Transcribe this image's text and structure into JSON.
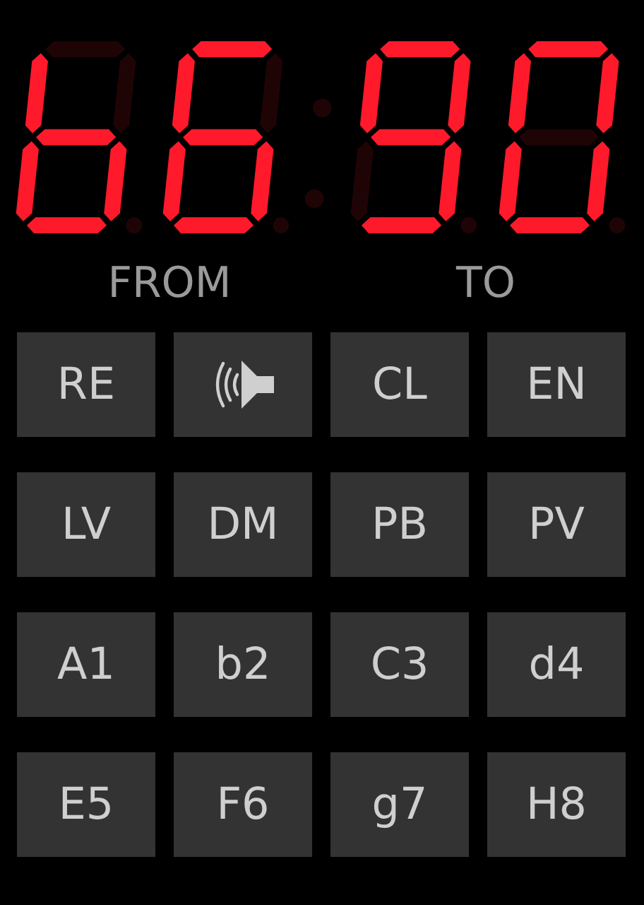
{
  "display": {
    "digits": [
      {
        "segments": [
          false,
          false,
          true,
          true,
          true,
          true,
          true
        ],
        "dot": false
      },
      {
        "segments": [
          true,
          false,
          true,
          true,
          true,
          true,
          true
        ],
        "dot": false
      },
      {
        "segments": [
          true,
          true,
          true,
          true,
          false,
          true,
          true
        ],
        "dot": false
      },
      {
        "segments": [
          true,
          true,
          true,
          true,
          true,
          true,
          false
        ],
        "dot": false
      }
    ],
    "colon": {
      "upper": false,
      "lower": false
    }
  },
  "labels": [
    "FROM",
    "TO"
  ],
  "buttons": [
    {
      "kind": "text",
      "label": "RE"
    },
    {
      "kind": "speaker"
    },
    {
      "kind": "text",
      "label": "CL"
    },
    {
      "kind": "text",
      "label": "EN"
    },
    {
      "kind": "text",
      "label": "LV"
    },
    {
      "kind": "text",
      "label": "DM"
    },
    {
      "kind": "text",
      "label": "PB"
    },
    {
      "kind": "text",
      "label": "PV"
    },
    {
      "kind": "text",
      "label": "A1"
    },
    {
      "kind": "text",
      "label": "b2"
    },
    {
      "kind": "text",
      "label": "C3"
    },
    {
      "kind": "text",
      "label": "d4"
    },
    {
      "kind": "text",
      "label": "E5"
    },
    {
      "kind": "text",
      "label": "F6"
    },
    {
      "kind": "text",
      "label": "g7"
    },
    {
      "kind": "text",
      "label": "H8"
    }
  ]
}
